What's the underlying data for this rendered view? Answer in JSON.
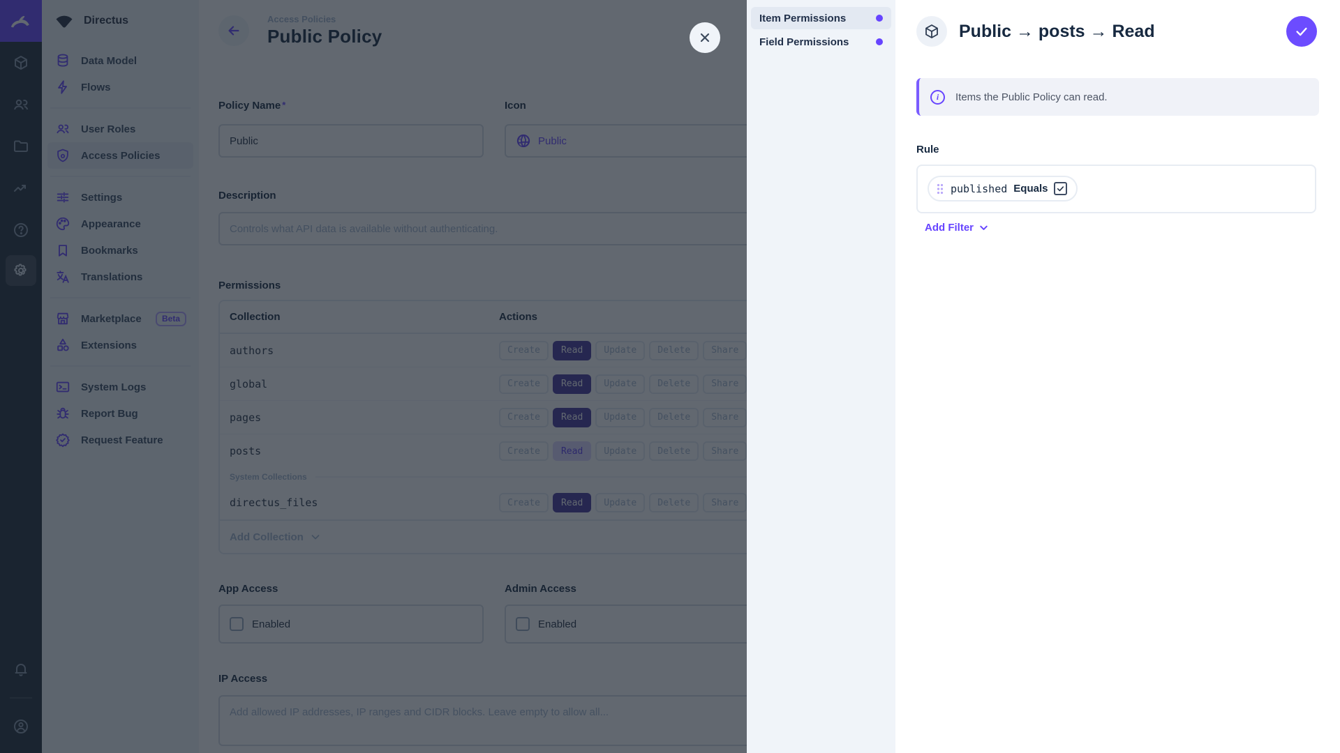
{
  "colors": {
    "accent": "#6644ff",
    "title_text": "#172940",
    "module_bar_bg": "#212c38",
    "panel_bg": "#f0f4f9"
  },
  "module_bar": {
    "logo_icon": "directus-rabbit-logo",
    "modules": [
      {
        "icon": "content-cube-icon"
      },
      {
        "icon": "users-icon"
      },
      {
        "icon": "files-folder-icon"
      },
      {
        "icon": "insights-chart-icon"
      },
      {
        "icon": "docs-help-icon"
      },
      {
        "icon": "settings-gear-icon",
        "active": true
      }
    ],
    "bottom": [
      {
        "icon": "notifications-bell-icon"
      },
      {
        "icon": "account-avatar-icon"
      }
    ]
  },
  "nav": {
    "project_name": "Directus",
    "project_icon": "project-wedge-icon",
    "sections": [
      {
        "items": [
          {
            "label": "Data Model",
            "icon": "database-icon"
          },
          {
            "label": "Flows",
            "icon": "bolt-icon"
          }
        ]
      },
      {
        "items": [
          {
            "label": "User Roles",
            "icon": "people-icon"
          },
          {
            "label": "Access Policies",
            "icon": "shield-policy-icon",
            "active": true
          }
        ]
      },
      {
        "items": [
          {
            "label": "Settings",
            "icon": "tune-icon"
          },
          {
            "label": "Appearance",
            "icon": "palette-icon"
          },
          {
            "label": "Bookmarks",
            "icon": "bookmark-icon"
          },
          {
            "label": "Translations",
            "icon": "translate-icon"
          }
        ]
      },
      {
        "items": [
          {
            "label": "Marketplace",
            "icon": "storefront-icon",
            "badge": "Beta"
          },
          {
            "label": "Extensions",
            "icon": "category-icon"
          }
        ]
      },
      {
        "items": [
          {
            "label": "System Logs",
            "icon": "terminal-icon"
          },
          {
            "label": "Report Bug",
            "icon": "bug-icon"
          },
          {
            "label": "Request Feature",
            "icon": "feature-seal-icon"
          }
        ]
      }
    ]
  },
  "main": {
    "breadcrumb": "Access Policies",
    "title": "Public Policy",
    "required_marker": "*",
    "policy_name": {
      "label": "Policy Name",
      "value": "Public"
    },
    "icon_field": {
      "label": "Icon",
      "value": "Public",
      "icon": "globe-icon"
    },
    "description": {
      "label": "Description",
      "placeholder": "Controls what API data is available without authenticating."
    },
    "app_access": {
      "label": "App Access",
      "checkbox_label": "Enabled",
      "checked": false
    },
    "admin_access": {
      "label": "Admin Access",
      "checkbox_label": "Enabled",
      "checked": false
    },
    "ip_access": {
      "label": "IP Access",
      "placeholder": "Add allowed IP addresses, IP ranges and CIDR blocks. Leave empty to allow all..."
    }
  },
  "permissions": {
    "section_label": "Permissions",
    "columns": {
      "collection": "Collection",
      "actions": "Actions"
    },
    "action_labels": [
      "Create",
      "Read",
      "Update",
      "Delete",
      "Share"
    ],
    "rows": [
      {
        "collection": "authors",
        "read_state": "granted"
      },
      {
        "collection": "global",
        "read_state": "granted"
      },
      {
        "collection": "pages",
        "read_state": "granted"
      },
      {
        "collection": "posts",
        "read_state": "editing"
      },
      {
        "collection": "directus_files",
        "read_state": "granted",
        "group": "system"
      }
    ],
    "system_divider_label": "System Collections",
    "add_collection_label": "Add Collection"
  },
  "drawer": {
    "nav": [
      {
        "label": "Item Permissions",
        "active": true
      },
      {
        "label": "Field Permissions"
      }
    ],
    "header": {
      "icon": "box-cube-icon",
      "title": "Public → posts → Read",
      "save_icon": "check-icon"
    },
    "banner": {
      "icon": "info-icon",
      "text": "Items the Public Policy can read."
    },
    "rule": {
      "label": "Rule",
      "filter": {
        "field": "published",
        "operator": "Equals",
        "value_checked": true
      },
      "add_filter_label": "Add Filter"
    }
  }
}
